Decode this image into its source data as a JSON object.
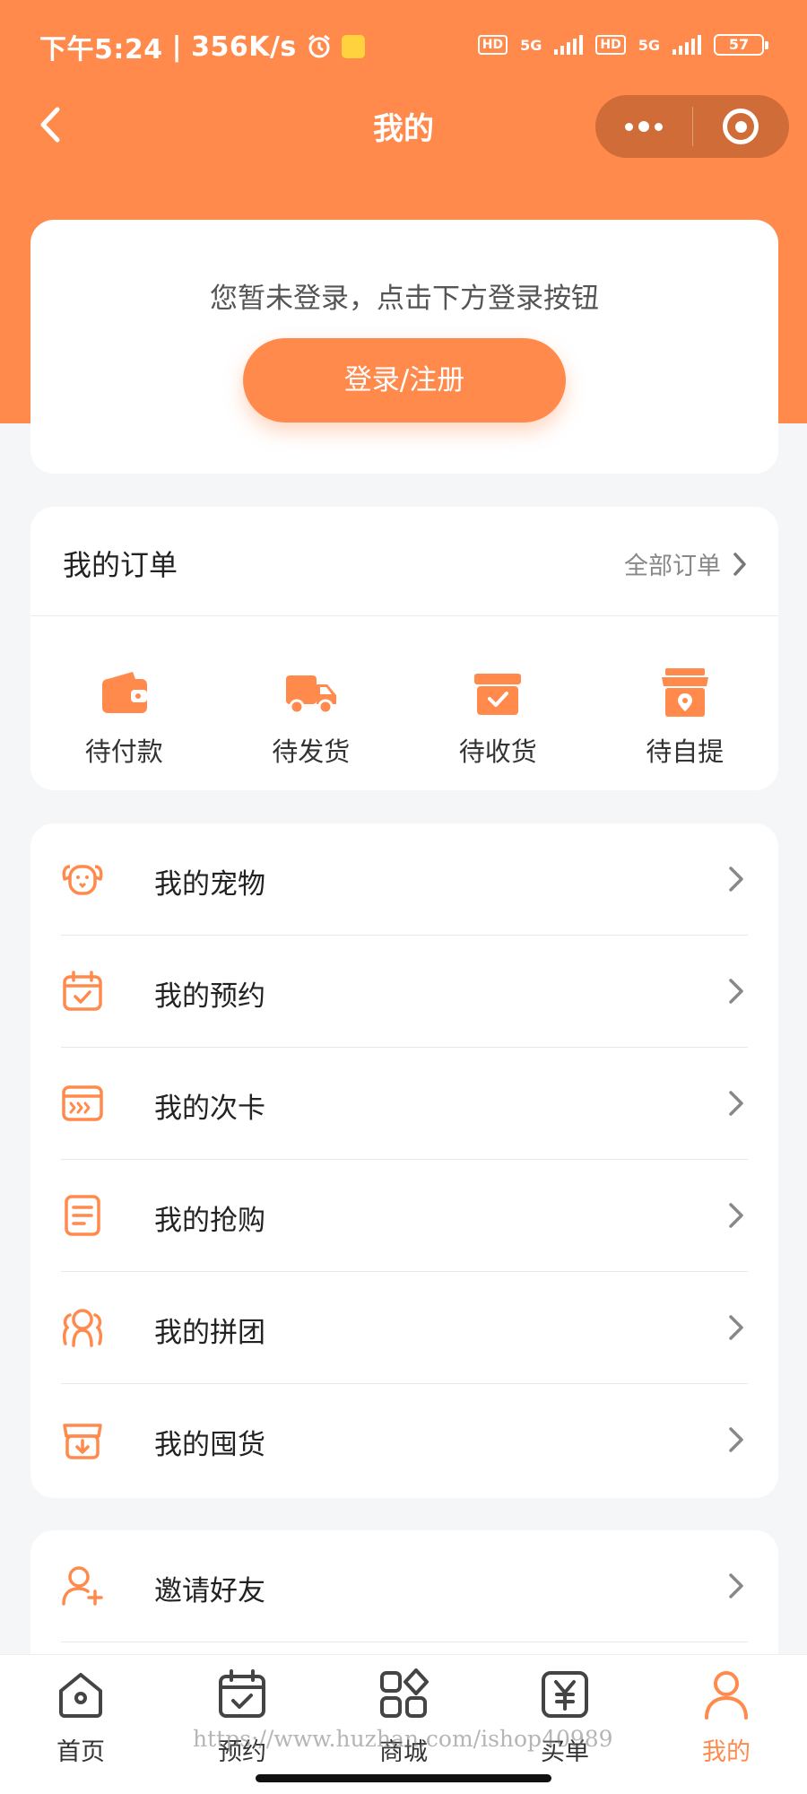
{
  "status_bar": {
    "time": "下午5:24",
    "speed": "356K/s",
    "hd1": "HD",
    "net1": "5G",
    "hd2": "HD",
    "net2": "5G",
    "battery": "57"
  },
  "nav": {
    "title": "我的",
    "back_icon": "chevron-left-icon",
    "more_icon": "more-dots-icon",
    "close_icon": "target-close-icon"
  },
  "login": {
    "tip": "您暂未登录，点击下方登录按钮",
    "button_label": "登录/注册"
  },
  "orders": {
    "title": "我的订单",
    "all_label": "全部订单",
    "items": [
      {
        "label": "待付款",
        "icon": "wallet-icon"
      },
      {
        "label": "待发货",
        "icon": "truck-icon"
      },
      {
        "label": "待收货",
        "icon": "box-check-icon"
      },
      {
        "label": "待自提",
        "icon": "store-location-icon"
      }
    ]
  },
  "menu": {
    "items": [
      {
        "label": "我的宠物",
        "icon": "dog-icon"
      },
      {
        "label": "我的预约",
        "icon": "calendar-check-icon"
      },
      {
        "label": "我的次卡",
        "icon": "card-icon"
      },
      {
        "label": "我的抢购",
        "icon": "document-list-icon"
      },
      {
        "label": "我的拼团",
        "icon": "group-icon"
      },
      {
        "label": "我的囤货",
        "icon": "stock-box-icon"
      }
    ]
  },
  "extra_menu": {
    "items": [
      {
        "label": "邀请好友",
        "icon": "add-user-icon"
      }
    ]
  },
  "tabbar": {
    "items": [
      {
        "label": "首页",
        "icon": "home-icon"
      },
      {
        "label": "预约",
        "icon": "calendar-check-icon"
      },
      {
        "label": "商城",
        "icon": "grid-icon"
      },
      {
        "label": "买单",
        "icon": "yuan-icon"
      },
      {
        "label": "我的",
        "icon": "person-icon",
        "active": true
      }
    ]
  },
  "watermark": "https://www.huzhan.com/ishop40989",
  "colors": {
    "accent": "#ff8a4c",
    "background": "#f5f6f8",
    "card": "#ffffff"
  }
}
